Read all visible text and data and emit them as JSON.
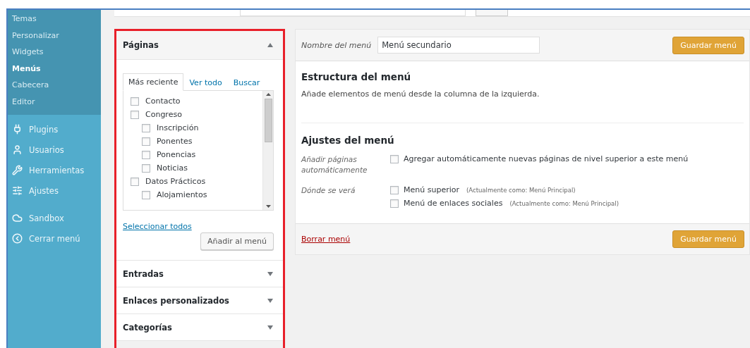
{
  "sidebar": {
    "submenu": [
      {
        "label": "Temas",
        "selected": false
      },
      {
        "label": "Personalizar",
        "selected": false
      },
      {
        "label": "Widgets",
        "selected": false
      },
      {
        "label": "Menús",
        "selected": true
      },
      {
        "label": "Cabecera",
        "selected": false
      },
      {
        "label": "Editor",
        "selected": false
      }
    ],
    "items": [
      {
        "label": "Plugins"
      },
      {
        "label": "Usuarios"
      },
      {
        "label": "Herramientas"
      },
      {
        "label": "Ajustes"
      },
      {
        "label": "Sandbox"
      },
      {
        "label": "Cerrar menú"
      }
    ]
  },
  "pages_panel": {
    "title": "Páginas",
    "expanded": true,
    "tabs": [
      {
        "label": "Más reciente",
        "selected": true
      },
      {
        "label": "Ver todo",
        "selected": false
      },
      {
        "label": "Buscar",
        "selected": false
      }
    ],
    "pages": [
      {
        "label": "Contacto",
        "checked": false
      },
      {
        "label": "Congreso",
        "checked": false,
        "children": [
          {
            "label": "Inscripción",
            "checked": false
          },
          {
            "label": "Ponentes",
            "checked": false
          },
          {
            "label": "Ponencias",
            "checked": false
          },
          {
            "label": "Noticias",
            "checked": false
          }
        ]
      },
      {
        "label": "Datos Prácticos",
        "checked": false,
        "children": [
          {
            "label": "Alojamientos",
            "checked": false
          }
        ]
      }
    ],
    "select_all": "Seleccionar todos",
    "add_button": "Añadir al menú"
  },
  "other_panels": [
    {
      "title": "Entradas",
      "expanded": false
    },
    {
      "title": "Enlaces personalizados",
      "expanded": false
    },
    {
      "title": "Categorías",
      "expanded": false
    }
  ],
  "menu_editor": {
    "name_label": "Nombre del menú",
    "name_value": "Menú secundario",
    "save_button": "Guardar menú",
    "structure_title": "Estructura del menú",
    "structure_text": "Añade elementos de menú desde la columna de la izquierda.",
    "settings_title": "Ajustes del menú",
    "settings": [
      {
        "label": "Añadir páginas automáticamente",
        "options": [
          {
            "label": "Agregar automáticamente nuevas páginas de nivel superior a este menú",
            "checked": false
          }
        ]
      },
      {
        "label": "Dónde se verá",
        "options": [
          {
            "label": "Menú superior",
            "note": "(Actualmente como: Menú Principal)",
            "checked": false
          },
          {
            "label": "Menú de enlaces sociales",
            "note": "(Actualmente como: Menú Principal)",
            "checked": false
          }
        ]
      }
    ],
    "delete_link": "Borrar menú",
    "footer_save_button": "Guardar menú"
  }
}
